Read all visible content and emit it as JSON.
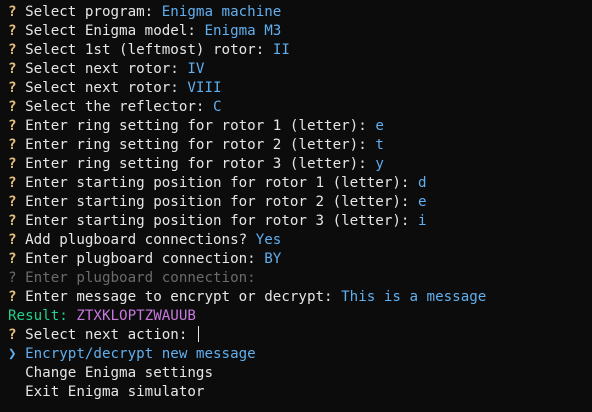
{
  "prompt_symbol": "?",
  "pointer_symbol": "❯",
  "lines": [
    {
      "question": "Select program: ",
      "answer": "Enigma machine"
    },
    {
      "question": "Select Enigma model: ",
      "answer": "Enigma M3"
    },
    {
      "question": "Select 1st (leftmost) rotor: ",
      "answer": "II"
    },
    {
      "question": "Select next rotor: ",
      "answer": "IV"
    },
    {
      "question": "Select next rotor: ",
      "answer": "VIII"
    },
    {
      "question": "Select the reflector: ",
      "answer": "C"
    },
    {
      "question": "Enter ring setting for rotor 1 (letter): ",
      "answer": "e"
    },
    {
      "question": "Enter ring setting for rotor 2 (letter): ",
      "answer": "t"
    },
    {
      "question": "Enter ring setting for rotor 3 (letter): ",
      "answer": "y"
    },
    {
      "question": "Enter starting position for rotor 1 (letter): ",
      "answer": "d"
    },
    {
      "question": "Enter starting position for rotor 2 (letter): ",
      "answer": "e"
    },
    {
      "question": "Enter starting position for rotor 3 (letter): ",
      "answer": "i"
    },
    {
      "question": "Add plugboard connections? ",
      "answer": "Yes"
    },
    {
      "question": "Enter plugboard connection: ",
      "answer": "BY"
    }
  ],
  "dimmed_line": {
    "question": "Enter plugboard connection:"
  },
  "message_line": {
    "question": "Enter message to encrypt or decrypt: ",
    "answer": "This is a message"
  },
  "result": {
    "label": "Result: ",
    "value": "ZTXKLOPTZWAUUB"
  },
  "next_action": {
    "question": "Select next action: "
  },
  "menu": {
    "selected": "Encrypt/decrypt new message",
    "options": [
      "Change Enigma settings",
      "Exit Enigma simulator"
    ]
  }
}
